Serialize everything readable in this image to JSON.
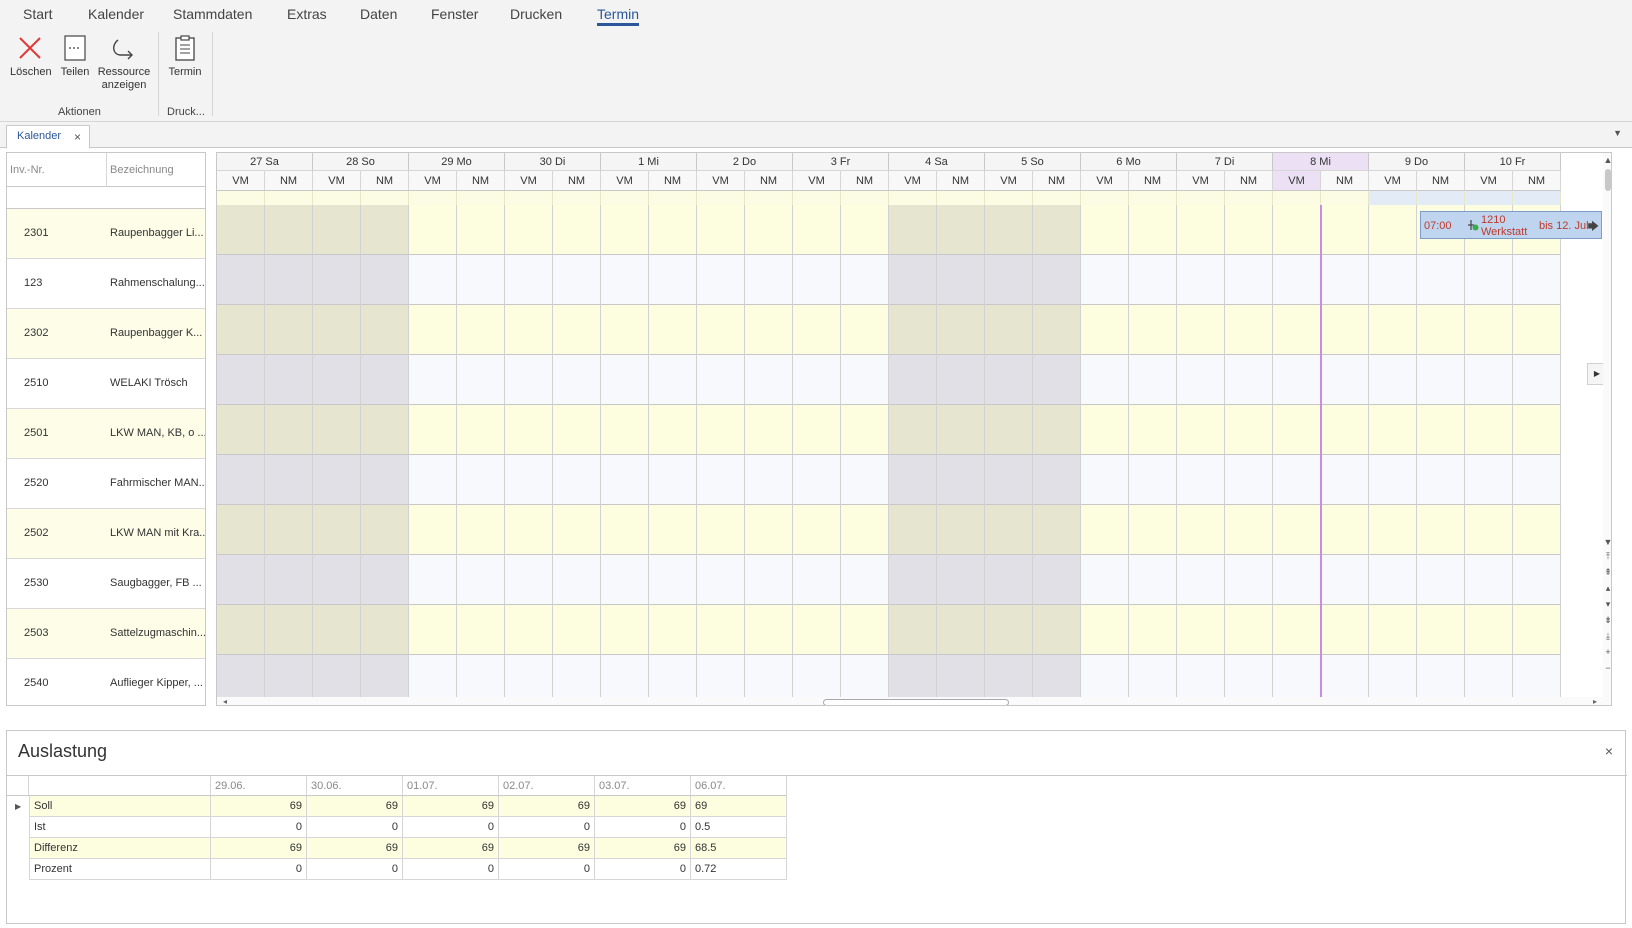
{
  "menu": {
    "tabs": [
      "Start",
      "Kalender",
      "Stammdaten",
      "Extras",
      "Daten",
      "Fenster",
      "Drucken",
      "Termin"
    ],
    "active": "Termin"
  },
  "ribbon": {
    "delete_label": "Löschen",
    "split_label": "Teilen",
    "resource_label_1": "Ressource",
    "resource_label_2": "anzeigen",
    "group_actions": "Aktionen",
    "appointment_label": "Termin",
    "group_print": "Druck..."
  },
  "doc_tab": {
    "label": "Kalender",
    "close": "×"
  },
  "resources": {
    "col_nr": "Inv.-Nr.",
    "col_name": "Bezeichnung",
    "rows": [
      {
        "nr": "2301",
        "name": "Raupenbagger Li..."
      },
      {
        "nr": "123",
        "name": "Rahmenschalung..."
      },
      {
        "nr": "2302",
        "name": "Raupenbagger K..."
      },
      {
        "nr": "2510",
        "name": "WELAKI Trösch"
      },
      {
        "nr": "2501",
        "name": "LKW MAN, KB, o ..."
      },
      {
        "nr": "2520",
        "name": "Fahrmischer MAN..."
      },
      {
        "nr": "2502",
        "name": "LKW MAN mit Kra..."
      },
      {
        "nr": "2530",
        "name": "Saugbagger, FB ..."
      },
      {
        "nr": "2503",
        "name": "Sattelzugmaschin..."
      },
      {
        "nr": "2540",
        "name": "Auflieger Kipper, ..."
      }
    ]
  },
  "scheduler": {
    "days": [
      {
        "label": "27 Sa",
        "weekend": true
      },
      {
        "label": "28 So",
        "weekend": true
      },
      {
        "label": "29 Mo",
        "weekend": false
      },
      {
        "label": "30 Di",
        "weekend": false
      },
      {
        "label": "1 Mi",
        "weekend": false
      },
      {
        "label": "2 Do",
        "weekend": false
      },
      {
        "label": "3 Fr",
        "weekend": false
      },
      {
        "label": "4 Sa",
        "weekend": true
      },
      {
        "label": "5 So",
        "weekend": true
      },
      {
        "label": "6 Mo",
        "weekend": false
      },
      {
        "label": "7 Di",
        "weekend": false
      },
      {
        "label": "8 Mi",
        "weekend": false,
        "today": true
      },
      {
        "label": "9 Do",
        "weekend": false
      },
      {
        "label": "10 Fr",
        "weekend": false
      }
    ],
    "half_labels": [
      "VM",
      "NM"
    ],
    "appointment": {
      "time": "07:00",
      "number": "1210",
      "location": "Werkstatt",
      "until": "bis 12. Jul",
      "arrow": "🡆"
    }
  },
  "utilization": {
    "title": "Auslastung",
    "close": "×",
    "columns": [
      "29.06.",
      "30.06.",
      "01.07.",
      "02.07.",
      "03.07.",
      "06.07."
    ],
    "rows": [
      {
        "label": "Soll",
        "values": [
          "69",
          "69",
          "69",
          "69",
          "69",
          "69"
        ]
      },
      {
        "label": "Ist",
        "values": [
          "0",
          "0",
          "0",
          "0",
          "0",
          "0.5"
        ]
      },
      {
        "label": "Differenz",
        "values": [
          "69",
          "69",
          "69",
          "69",
          "69",
          "68.5"
        ]
      },
      {
        "label": "Prozent",
        "values": [
          "0",
          "0",
          "0",
          "0",
          "0",
          "0.72"
        ]
      }
    ]
  },
  "colors": {
    "accent": "#2b579a",
    "weekend_odd": "#e6e6d0",
    "weekend_even": "#e0e0e6",
    "workday_odd": "#fdfde0",
    "workday_even": "#f8f9fd",
    "today_line": "#c98ce0",
    "appointment_bg": "#bfd5ef",
    "appointment_text": "#c0392b"
  }
}
